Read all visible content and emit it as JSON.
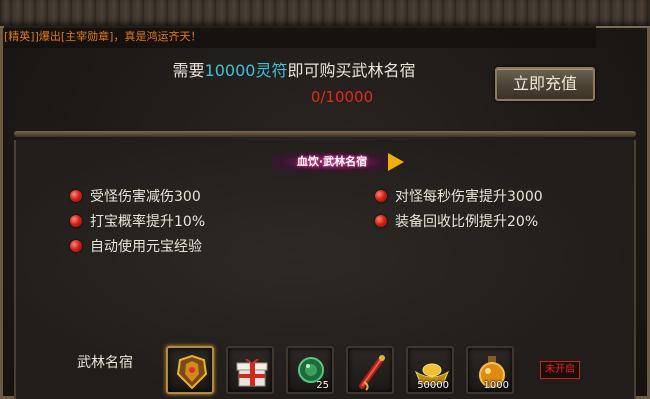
{
  "broadcast": "[精英]]爆出[主宰勋章]，真是鸿运齐天！",
  "purchase": {
    "prefix": "需要",
    "amount": "10000灵符",
    "suffix": "即可购买武林名宿",
    "progress": "0/10000",
    "recharge_label": "立即充值"
  },
  "title_banner": "血饮·武林名宿",
  "benefits": [
    "受怪伤害减伤300",
    "打宝概率提升10%",
    "自动使用元宝经验",
    "对怪每秒伤害提升3000",
    "装备回收比例提升20%"
  ],
  "rewards": {
    "label": "武林名宿",
    "items": [
      {
        "icon": "golden-armor-icon",
        "count": ""
      },
      {
        "icon": "gift-box-icon",
        "count": ""
      },
      {
        "icon": "green-gem-icon",
        "count": "25"
      },
      {
        "icon": "red-scroll-icon",
        "count": ""
      },
      {
        "icon": "gold-ingot-icon",
        "count": "50000"
      },
      {
        "icon": "potion-flask-icon",
        "count": "1000"
      }
    ],
    "status": "未开启"
  },
  "colors": {
    "highlight": "#39c4d8",
    "progress": "#e02a1a",
    "broadcast": "#e07a1a",
    "arrow": "#f0b000"
  }
}
